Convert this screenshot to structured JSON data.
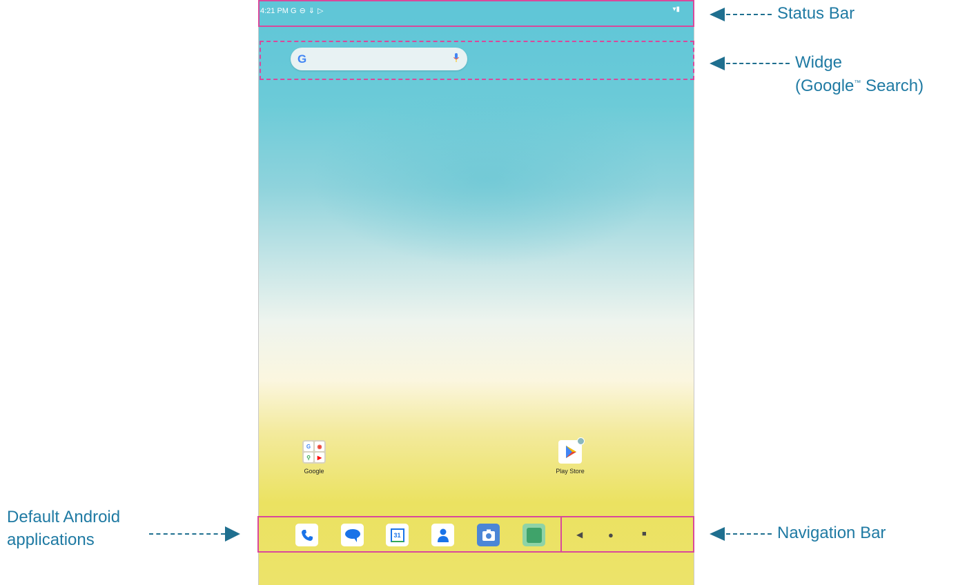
{
  "status_bar": {
    "time": "4:21 PM",
    "icons": [
      "G",
      "⊖",
      "⇓",
      "▷"
    ],
    "right_icons": "▾▮"
  },
  "search_widget": {
    "logo": "G",
    "mic_icon": "mic-icon"
  },
  "apps": [
    {
      "label": "Google",
      "folder": [
        "G",
        "◉",
        "⚲",
        "▶"
      ]
    },
    {
      "label": "Play Store"
    }
  ],
  "dock": {
    "icons": [
      "phone-icon",
      "messages-icon",
      "calendar-icon",
      "contacts-icon",
      "camera-icon",
      "launcher-icon"
    ],
    "calendar_day": "31"
  },
  "nav_bar": {
    "back": "◀",
    "home": "●",
    "recents": "■"
  },
  "annotations": {
    "status_bar": "Status Bar",
    "widget_line1": "Widge",
    "widget_line2_pre": "(Google",
    "widget_tm": "™",
    "widget_line2_post": " Search)",
    "default_apps_line1": "Default Android",
    "default_apps_line2": "applications",
    "navigation_bar": "Navigation Bar"
  },
  "colors": {
    "annotation_text": "#1f7aa3",
    "highlight_box": "#d9489b",
    "arrow": "#1f6f8f"
  }
}
